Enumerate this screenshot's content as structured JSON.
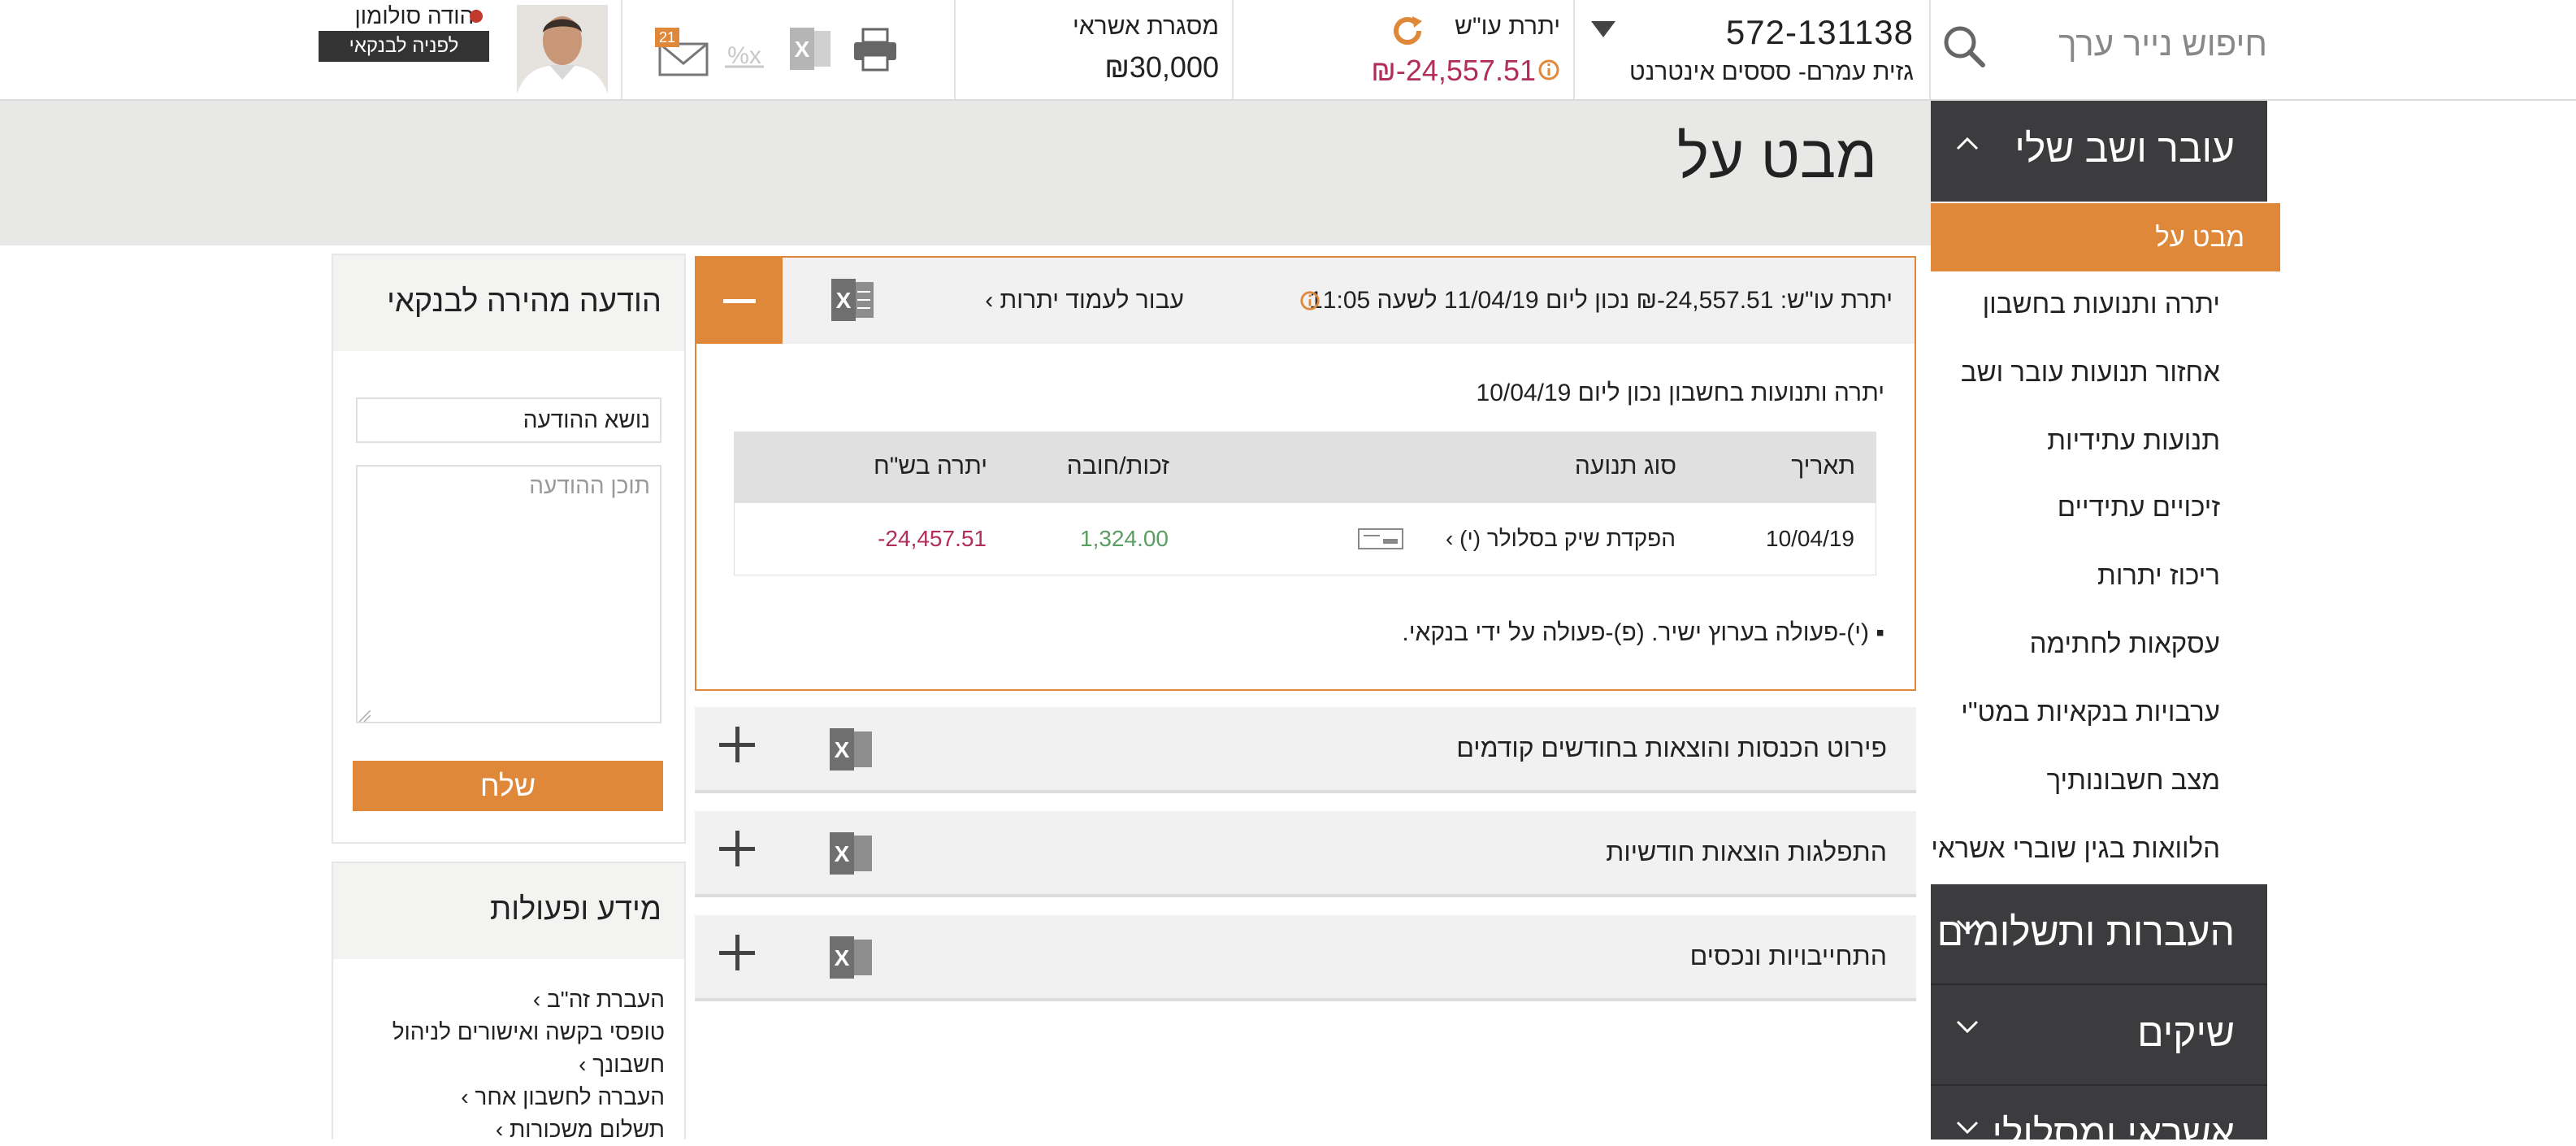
{
  "header": {
    "search_placeholder": "חיפוש נייר ערך",
    "account_number": "572-131138",
    "account_name": "גזית עמרם- סססים אינטרנט",
    "balance_label": "יתרת עו\"ש",
    "balance_value": "₪-24,557.51",
    "credit_label": "מסגרת אשראי",
    "credit_value": "₪30,000",
    "mail_count": "21",
    "user_name": "יהודה סולומון",
    "contact_banker": "לפניה לבנקאי"
  },
  "page": {
    "title": "מבט על"
  },
  "sidebar": {
    "sections": [
      {
        "label": "עובר ושב שלי",
        "expanded": true
      },
      {
        "label": "העברות ותשלומים",
        "expanded": false
      },
      {
        "label": "שיקים",
        "expanded": false
      },
      {
        "label": "אשראי ומסלולי",
        "expanded": false
      }
    ],
    "items": [
      {
        "label": "מבט על",
        "active": true
      },
      {
        "label": "יתרה ותנועות בחשבון"
      },
      {
        "label": "אחזור תנועות עובר ושב"
      },
      {
        "label": "תנועות עתידיות"
      },
      {
        "label": "זיכויים עתידיים"
      },
      {
        "label": "ריכוז יתרות"
      },
      {
        "label": "עסקאות לחתימה"
      },
      {
        "label": "ערבויות בנקאיות במט\"י"
      },
      {
        "label": "מצב חשבונותיך"
      },
      {
        "label": "הלוואות בגין שוברי אשראי"
      }
    ]
  },
  "main": {
    "panel_open": {
      "balance_line": "יתרת עו\"ש: 24,557.51-₪ נכון ליום 11/04/19 לשעה 11:05",
      "goto_link": "עבור לעמוד יתרות",
      "subheading": "יתרה ותנועות בחשבון נכון ליום 10/04/19",
      "columns": [
        "תאריך",
        "סוג תנועה",
        "זכות/חובה",
        "יתרה בש\"ח"
      ],
      "rows": [
        {
          "date": "10/04/19",
          "type": "הפקדת שיק בסלולר (י)",
          "amount": "1,324.00",
          "balance": "-24,457.51"
        }
      ],
      "footnote": "(י)-פעולה בערוץ ישיר. (פ)-פעולה על ידי בנקאי."
    },
    "panels_closed": [
      {
        "title": "פירוט הכנסות והוצאות בחודשים קודמים"
      },
      {
        "title": "התפלגות הוצאות חודשיות"
      },
      {
        "title": "התחייבויות ונכסים"
      }
    ]
  },
  "message_widget": {
    "title": "הודעה מהירה לבנקאי",
    "subject_placeholder": "נושא ההודעה",
    "body_placeholder": "תוכן ההודעה",
    "send_label": "שלח"
  },
  "info_widget": {
    "title": "מידע ופעולות",
    "links": [
      "העברת זה\"ב",
      "טופסי בקשה ואישורים לניהול חשבונך",
      "העברה לחשבון אחר",
      "תשלום משכורות"
    ]
  },
  "colors": {
    "accent": "#e0883a",
    "sidebar_dark": "#3c3c3e",
    "negative": "#b22e58",
    "positive": "#5a9e63"
  }
}
